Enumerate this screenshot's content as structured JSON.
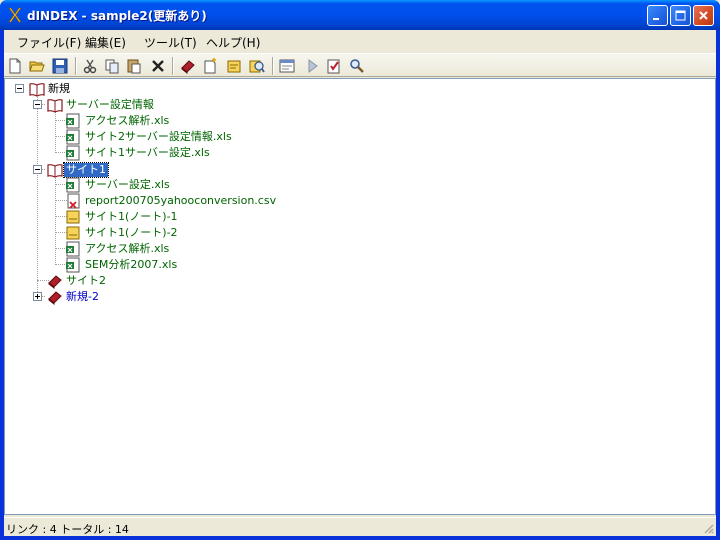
{
  "window": {
    "title": "dINDEX - sample2(更新あり)"
  },
  "menu": [
    {
      "label": "ファイル(F)"
    },
    {
      "label": "編集(E)"
    },
    {
      "label": "ツール(T)"
    },
    {
      "label": "ヘルプ(H)"
    }
  ],
  "toolbar": {
    "buttons": [
      "new-file",
      "open-folder",
      "save",
      "cut",
      "copy",
      "paste",
      "delete",
      "book",
      "new-item",
      "note",
      "find-link",
      "view",
      "run",
      "check",
      "search"
    ]
  },
  "tree": {
    "root": {
      "label": "新規"
    },
    "group1": {
      "label": "サーバー設定情報"
    },
    "group1_items": [
      {
        "label": "アクセス解析.xls"
      },
      {
        "label": "サイト2サーバー設定情報.xls"
      },
      {
        "label": "サイト1サーバー設定.xls"
      }
    ],
    "group2": {
      "label": "サイト1"
    },
    "group2_items": [
      {
        "label": "サーバー設定.xls"
      },
      {
        "label": "report200705yahooconversion.csv"
      },
      {
        "label": "サイト1(ノート)-1"
      },
      {
        "label": "サイト1(ノート)-2"
      },
      {
        "label": "アクセス解析.xls"
      },
      {
        "label": "SEM分析2007.xls"
      }
    ],
    "group3": {
      "label": "サイト2"
    },
    "group4": {
      "label": "新規-2"
    }
  },
  "status": {
    "text": "リンク : 4  トータル : 14"
  },
  "colors": {
    "folder_label": "#006400",
    "link_label": "#0000C8",
    "selection": "#316AC5"
  }
}
